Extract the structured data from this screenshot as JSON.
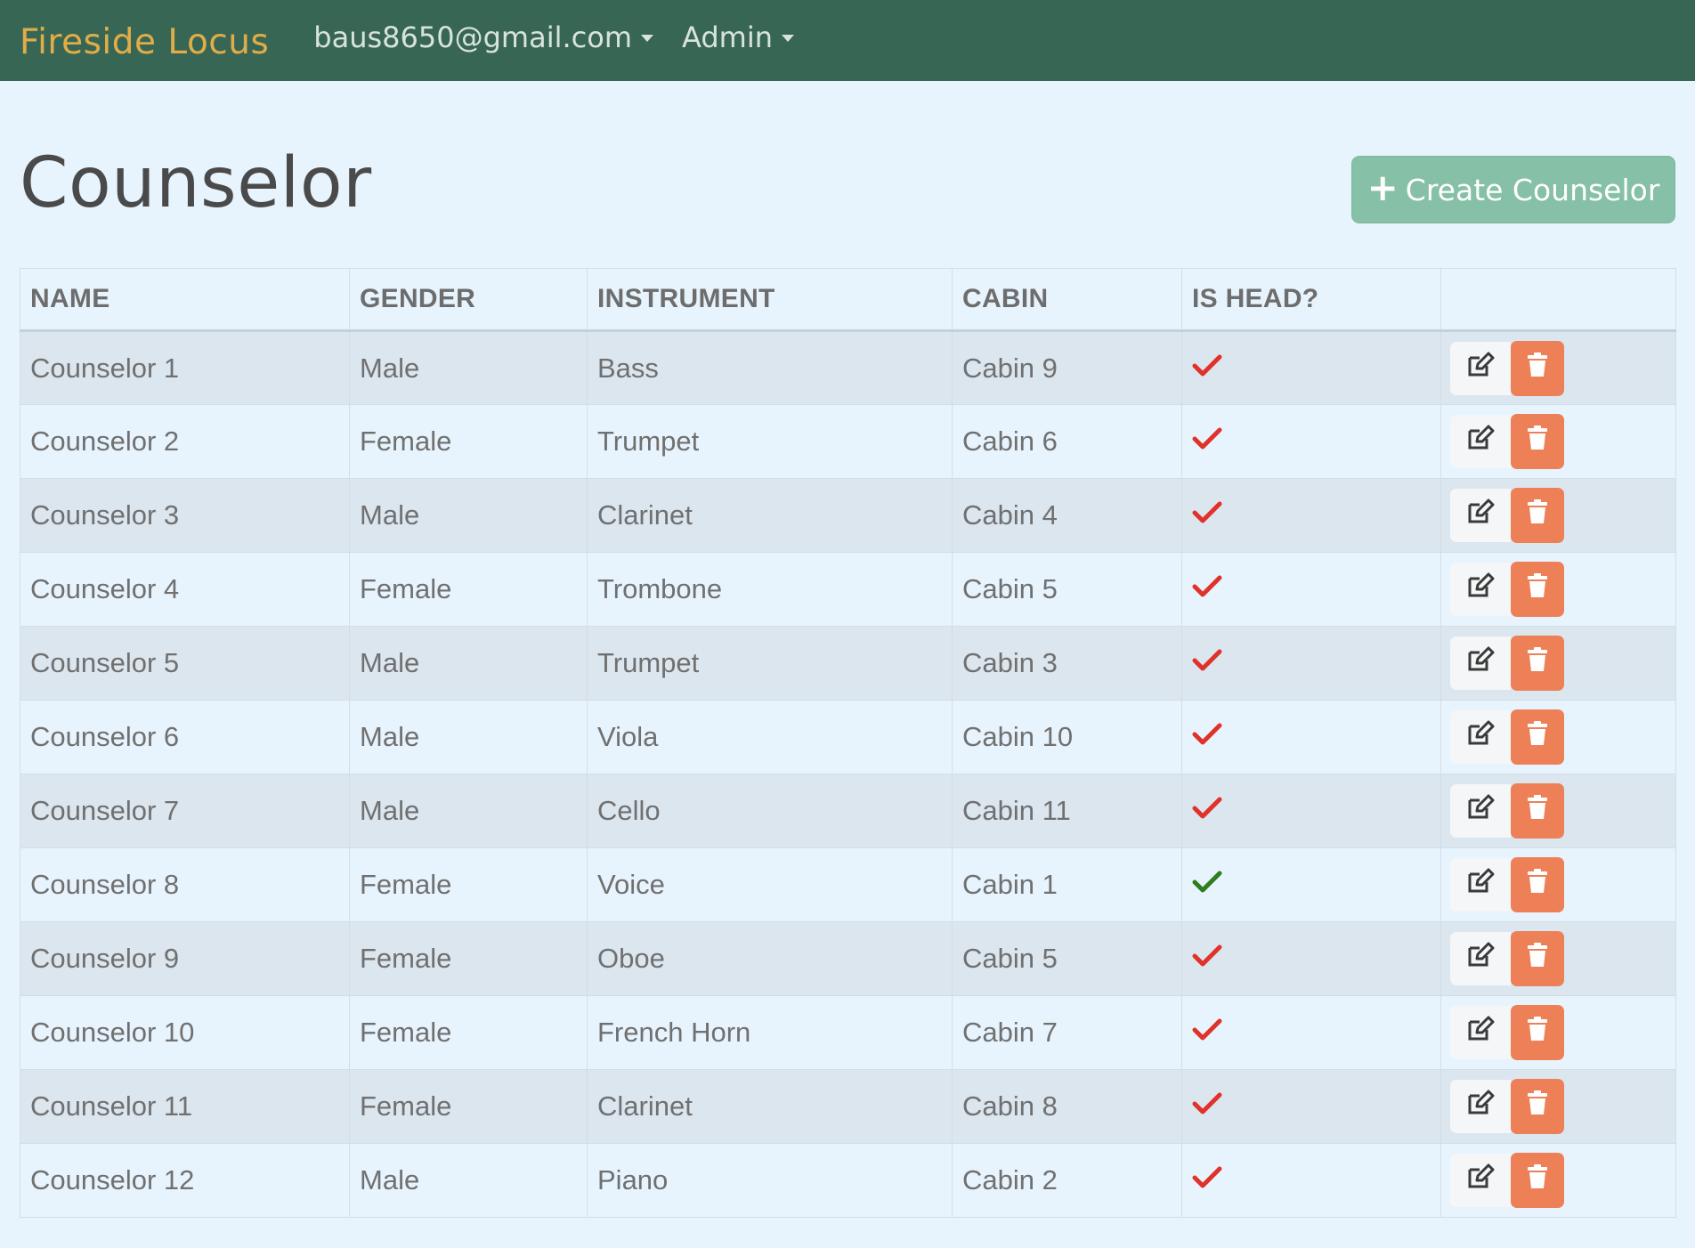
{
  "nav": {
    "brand": "Fireside Locus",
    "user_menu": "baus8650@gmail.com",
    "admin_menu": "Admin"
  },
  "page": {
    "title": "Counselor",
    "create_button": "Create Counselor"
  },
  "table": {
    "columns": [
      "NAME",
      "GENDER",
      "INSTRUMENT",
      "CABIN",
      "IS HEAD?",
      ""
    ],
    "rows": [
      {
        "name": "Counselor 1",
        "gender": "Male",
        "instrument": "Bass",
        "cabin": "Cabin 9",
        "is_head": false
      },
      {
        "name": "Counselor 2",
        "gender": "Female",
        "instrument": "Trumpet",
        "cabin": "Cabin 6",
        "is_head": false
      },
      {
        "name": "Counselor 3",
        "gender": "Male",
        "instrument": "Clarinet",
        "cabin": "Cabin 4",
        "is_head": false
      },
      {
        "name": "Counselor 4",
        "gender": "Female",
        "instrument": "Trombone",
        "cabin": "Cabin 5",
        "is_head": false
      },
      {
        "name": "Counselor 5",
        "gender": "Male",
        "instrument": "Trumpet",
        "cabin": "Cabin 3",
        "is_head": false
      },
      {
        "name": "Counselor 6",
        "gender": "Male",
        "instrument": "Viola",
        "cabin": "Cabin 10",
        "is_head": false
      },
      {
        "name": "Counselor 7",
        "gender": "Male",
        "instrument": "Cello",
        "cabin": "Cabin 11",
        "is_head": false
      },
      {
        "name": "Counselor 8",
        "gender": "Female",
        "instrument": "Voice",
        "cabin": "Cabin 1",
        "is_head": true
      },
      {
        "name": "Counselor 9",
        "gender": "Female",
        "instrument": "Oboe",
        "cabin": "Cabin 5",
        "is_head": false
      },
      {
        "name": "Counselor 10",
        "gender": "Female",
        "instrument": "French Horn",
        "cabin": "Cabin 7",
        "is_head": false
      },
      {
        "name": "Counselor 11",
        "gender": "Female",
        "instrument": "Clarinet",
        "cabin": "Cabin 8",
        "is_head": false
      },
      {
        "name": "Counselor 12",
        "gender": "Male",
        "instrument": "Piano",
        "cabin": "Cabin 2",
        "is_head": false
      }
    ]
  },
  "icons": {
    "is_head_true": "check-icon",
    "is_head_false": "check-icon",
    "edit": "edit-icon",
    "delete": "trash-icon"
  },
  "colors": {
    "navbar": "#386655",
    "brand": "#e0ad48",
    "create_button": "#86c0a6",
    "check_true": "#2e7d1f",
    "check_false": "#e0322b",
    "delete_button": "#ee8058"
  }
}
